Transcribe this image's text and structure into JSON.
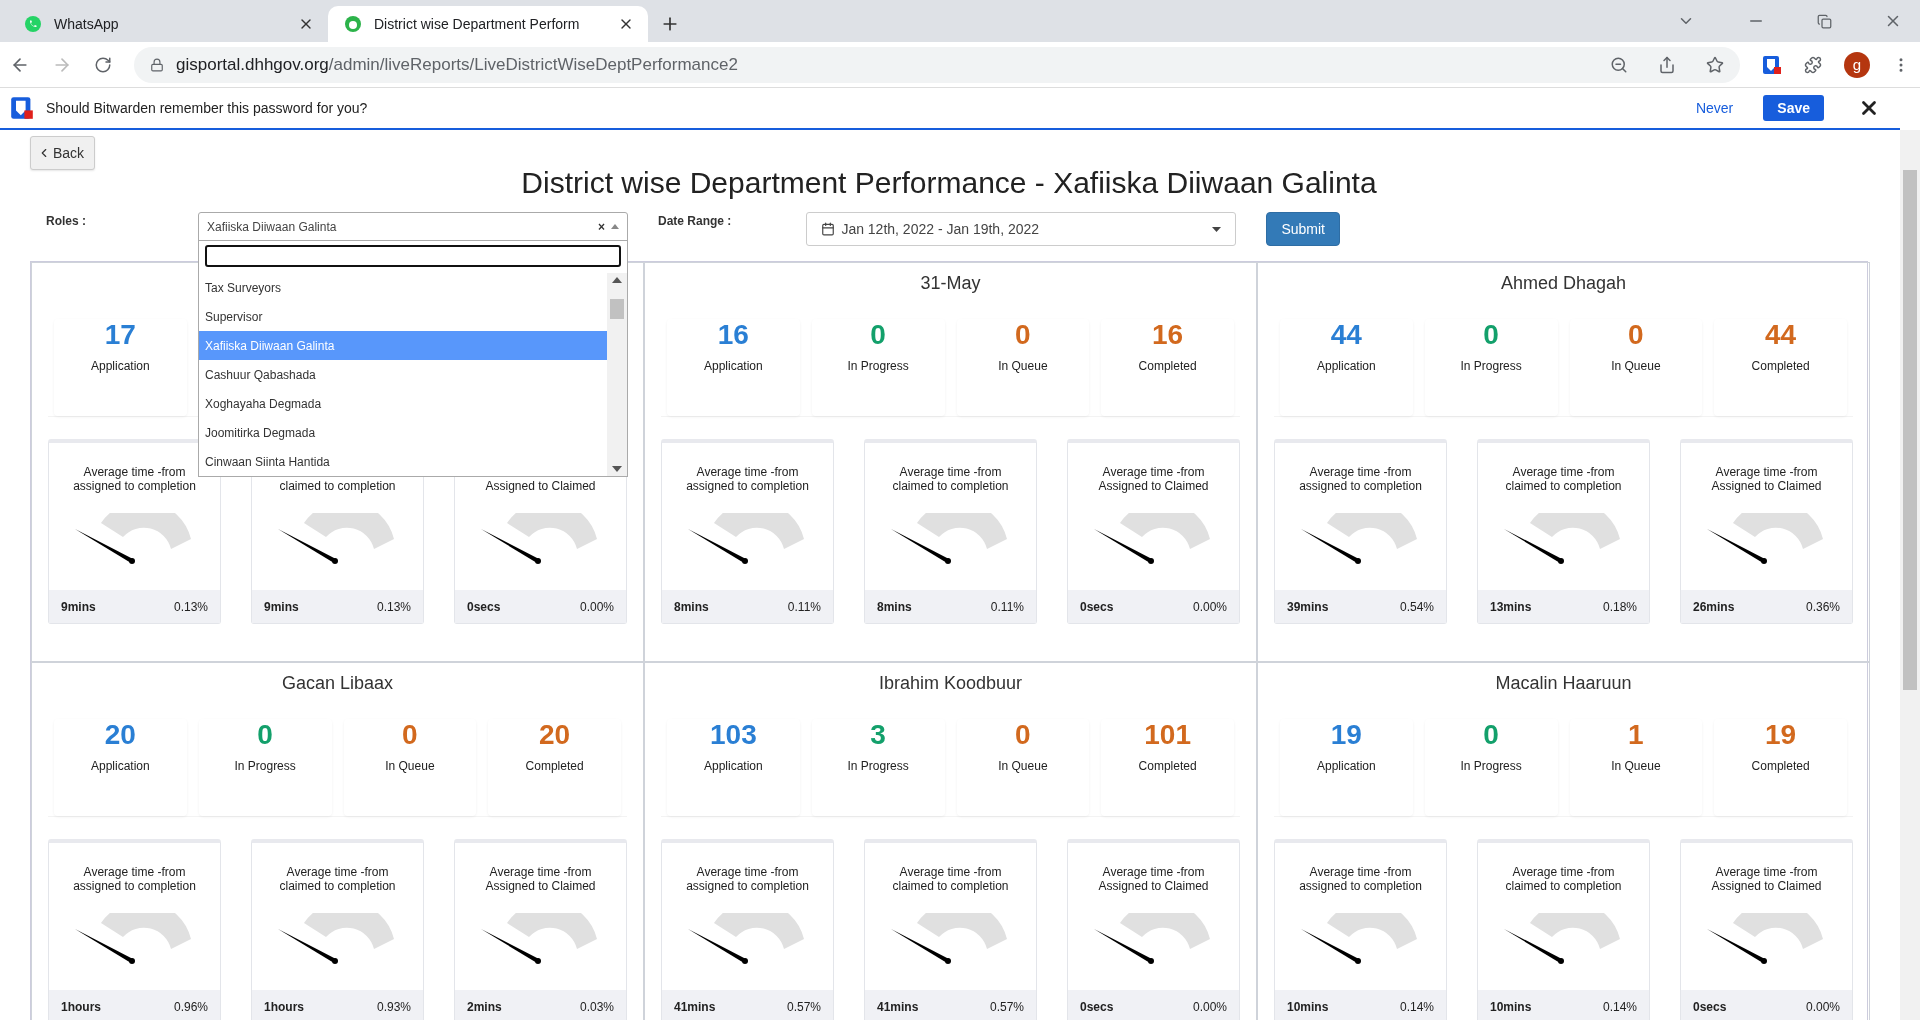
{
  "browser": {
    "tabs": [
      {
        "title": "WhatsApp",
        "kind": "whatsapp",
        "selected": false
      },
      {
        "title": "District wise Department Perform",
        "kind": "site",
        "selected": true
      }
    ],
    "url": {
      "host": "gisportal.dhhgov.org",
      "path": "/admin/liveReports/LiveDistrictWiseDeptPerformance2"
    },
    "profile": "g"
  },
  "bitwarden": {
    "message": "Should Bitwarden remember this password for you?",
    "never": "Never",
    "save": "Save"
  },
  "back": "Back",
  "title": "District wise Department Performance - Xafiiska Diiwaan Galinta",
  "roles": {
    "label": "Roles :",
    "value": "Xafiiska Diiwaan Galinta",
    "clear": "×",
    "options": [
      {
        "label": "Tax Surveyors",
        "selected": false
      },
      {
        "label": "Supervisor",
        "selected": false
      },
      {
        "label": "Xafiiska Diiwaan Galinta",
        "selected": true
      },
      {
        "label": "Cashuur Qabashada",
        "selected": false
      },
      {
        "label": "Xoghayaha Degmada",
        "selected": false
      },
      {
        "label": "Joomitirka Degmada",
        "selected": false
      },
      {
        "label": "Cinwaan Siinta Hantida",
        "selected": false
      }
    ]
  },
  "date_range": {
    "label": "Date Range :",
    "value": "Jan 12th, 2022 - Jan 19th, 2022"
  },
  "submit": "Submit",
  "panels": [
    {
      "stats": [
        {
          "kind": "application",
          "value": "17",
          "label": "Application"
        }
      ],
      "gauges": [
        {
          "title": "Average time -from assigned to completion",
          "time": "9mins",
          "percent": "0.13%"
        },
        {
          "title": "claimed to completion",
          "first_line_hidden": true,
          "time": "9mins",
          "percent": "0.13%"
        },
        {
          "title": "Assigned to Claimed",
          "first_line_hidden": true,
          "time": "0secs",
          "percent": "0.00%"
        }
      ]
    },
    {
      "title": "31-May",
      "stats": [
        {
          "kind": "application",
          "value": "16",
          "label": "Application"
        },
        {
          "kind": "progress",
          "value": "0",
          "label": "In Progress"
        },
        {
          "kind": "queue",
          "value": "0",
          "label": "In Queue"
        },
        {
          "kind": "completed",
          "value": "16",
          "label": "Completed"
        }
      ],
      "gauges": [
        {
          "title": "Average time -from assigned to completion",
          "time": "8mins",
          "percent": "0.11%"
        },
        {
          "title": "Average time -from claimed to completion",
          "time": "8mins",
          "percent": "0.11%"
        },
        {
          "title": "Average time -from Assigned to Claimed",
          "time": "0secs",
          "percent": "0.00%"
        }
      ]
    },
    {
      "title": "Ahmed Dhagah",
      "stats": [
        {
          "kind": "application",
          "value": "44",
          "label": "Application"
        },
        {
          "kind": "progress",
          "value": "0",
          "label": "In Progress"
        },
        {
          "kind": "queue",
          "value": "0",
          "label": "In Queue"
        },
        {
          "kind": "completed",
          "value": "44",
          "label": "Completed"
        }
      ],
      "gauges": [
        {
          "title": "Average time -from assigned to completion",
          "time": "39mins",
          "percent": "0.54%"
        },
        {
          "title": "Average time -from claimed to completion",
          "time": "13mins",
          "percent": "0.18%"
        },
        {
          "title": "Average time -from Assigned to Claimed",
          "time": "26mins",
          "percent": "0.36%"
        }
      ]
    },
    {
      "title": "Gacan Libaax",
      "stats": [
        {
          "kind": "application",
          "value": "20",
          "label": "Application"
        },
        {
          "kind": "progress",
          "value": "0",
          "label": "In Progress"
        },
        {
          "kind": "queue",
          "value": "0",
          "label": "In Queue"
        },
        {
          "kind": "completed",
          "value": "20",
          "label": "Completed"
        }
      ],
      "gauges": [
        {
          "title": "Average time -from assigned to completion",
          "time": "1hours",
          "percent": "0.96%"
        },
        {
          "title": "Average time -from claimed to completion",
          "time": "1hours",
          "percent": "0.93%"
        },
        {
          "title": "Average time -from Assigned to Claimed",
          "time": "2mins",
          "percent": "0.03%"
        }
      ]
    },
    {
      "title": "Ibrahim Koodbuur",
      "stats": [
        {
          "kind": "application",
          "value": "103",
          "label": "Application"
        },
        {
          "kind": "progress",
          "value": "3",
          "label": "In Progress"
        },
        {
          "kind": "queue",
          "value": "0",
          "label": "In Queue"
        },
        {
          "kind": "completed",
          "value": "101",
          "label": "Completed"
        }
      ],
      "gauges": [
        {
          "title": "Average time -from assigned to completion",
          "time": "41mins",
          "percent": "0.57%"
        },
        {
          "title": "Average time -from claimed to completion",
          "time": "41mins",
          "percent": "0.57%"
        },
        {
          "title": "Average time -from Assigned to Claimed",
          "time": "0secs",
          "percent": "0.00%"
        }
      ]
    },
    {
      "title": "Macalin Haaruun",
      "stats": [
        {
          "kind": "application",
          "value": "19",
          "label": "Application"
        },
        {
          "kind": "progress",
          "value": "0",
          "label": "In Progress"
        },
        {
          "kind": "queue",
          "value": "1",
          "label": "In Queue"
        },
        {
          "kind": "completed",
          "value": "19",
          "label": "Completed"
        }
      ],
      "gauges": [
        {
          "title": "Average time -from assigned to completion",
          "time": "10mins",
          "percent": "0.14%"
        },
        {
          "title": "Average time -from claimed to completion",
          "time": "10mins",
          "percent": "0.14%"
        },
        {
          "title": "Average time -from Assigned to Claimed",
          "time": "0secs",
          "percent": "0.00%"
        }
      ]
    }
  ]
}
